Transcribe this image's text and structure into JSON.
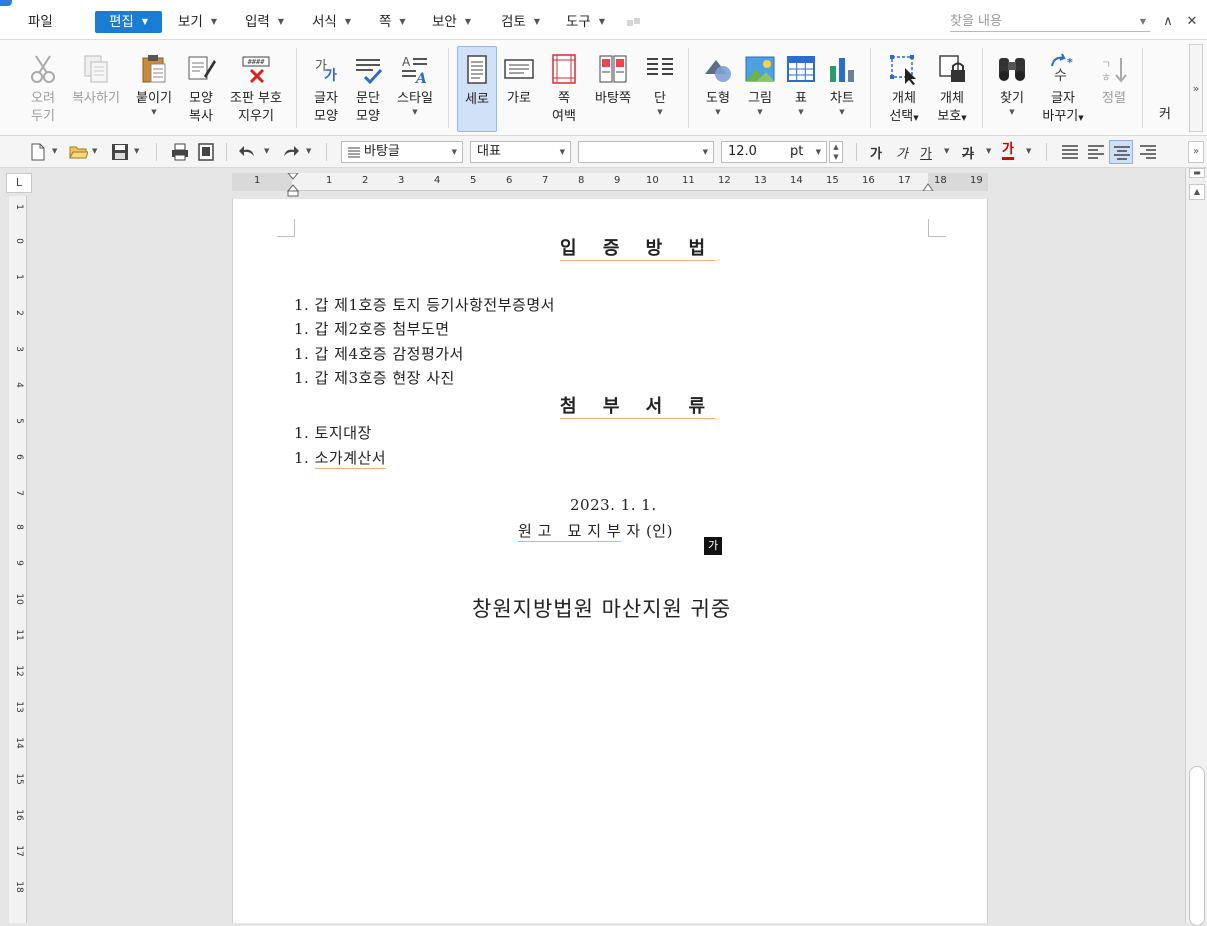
{
  "menubar": {
    "items": [
      "파일",
      "편집",
      "보기",
      "입력",
      "서식",
      "쪽",
      "보안",
      "검토",
      "도구"
    ],
    "active": "편집",
    "search_placeholder": "찾을 내용"
  },
  "ribbon": {
    "cut": [
      "오려",
      "두기"
    ],
    "copy": [
      "복사하기"
    ],
    "paste": [
      "붙이기"
    ],
    "format_copy": [
      "모양",
      "복사"
    ],
    "clear_codes": [
      "조판 부호",
      "지우기"
    ],
    "char_shape": [
      "글자",
      "모양"
    ],
    "para_shape": [
      "문단",
      "모양"
    ],
    "style": [
      "스타일"
    ],
    "portrait": [
      "세로"
    ],
    "landscape": [
      "가로"
    ],
    "page_margin": [
      "쪽",
      "여백"
    ],
    "background": [
      "바탕쪽"
    ],
    "column": [
      "단"
    ],
    "shape": [
      "도형"
    ],
    "picture": [
      "그림"
    ],
    "table": [
      "표"
    ],
    "chart": [
      "차트"
    ],
    "select_object": [
      "개체",
      "선택"
    ],
    "protect_object": [
      "개체",
      "보호"
    ],
    "find": [
      "찾기"
    ],
    "replace": [
      "글자",
      "바꾸기"
    ],
    "sort": [
      "정렬"
    ],
    "more": [
      "커"
    ]
  },
  "toolbar": {
    "style_value": "바탕글",
    "font_lang": "대표",
    "font_name": "",
    "font_size": "12.0",
    "unit": "pt",
    "char_buttons": [
      "가",
      "가",
      "가",
      "가",
      "가"
    ]
  },
  "ruler": {
    "h_numbers": [
      "1",
      "1",
      "2",
      "3",
      "4",
      "5",
      "6",
      "7",
      "8",
      "9",
      "10",
      "11",
      "12",
      "13",
      "14",
      "15",
      "16",
      "17",
      "18",
      "19"
    ],
    "v_numbers": [
      "1",
      "0",
      "1",
      "2",
      "3",
      "4",
      "5",
      "6",
      "7",
      "8",
      "9",
      "10",
      "11",
      "12",
      "13",
      "14",
      "15",
      "16",
      "17",
      "18"
    ],
    "corner": "L"
  },
  "document": {
    "title1": "입 증 방 법",
    "list1": [
      "1. 갑 제1호증 토지 등기사항전부증명서",
      "1. 갑 제2호증 첨부도면",
      "1. 갑 제4호증 감정평가서",
      "1. 갑 제3호증 현장 사진"
    ],
    "title2": "첨 부 서 류",
    "list2_prefix": "1.",
    "list2": [
      "토지대장",
      "소가계산서"
    ],
    "date": "2023. 1. 1.",
    "signer_underlined": "원 고   묘 지 부",
    "signer_rest": " 자 (인)",
    "cursor_char": "가",
    "court": "창원지방법원 마산지원 귀중"
  }
}
